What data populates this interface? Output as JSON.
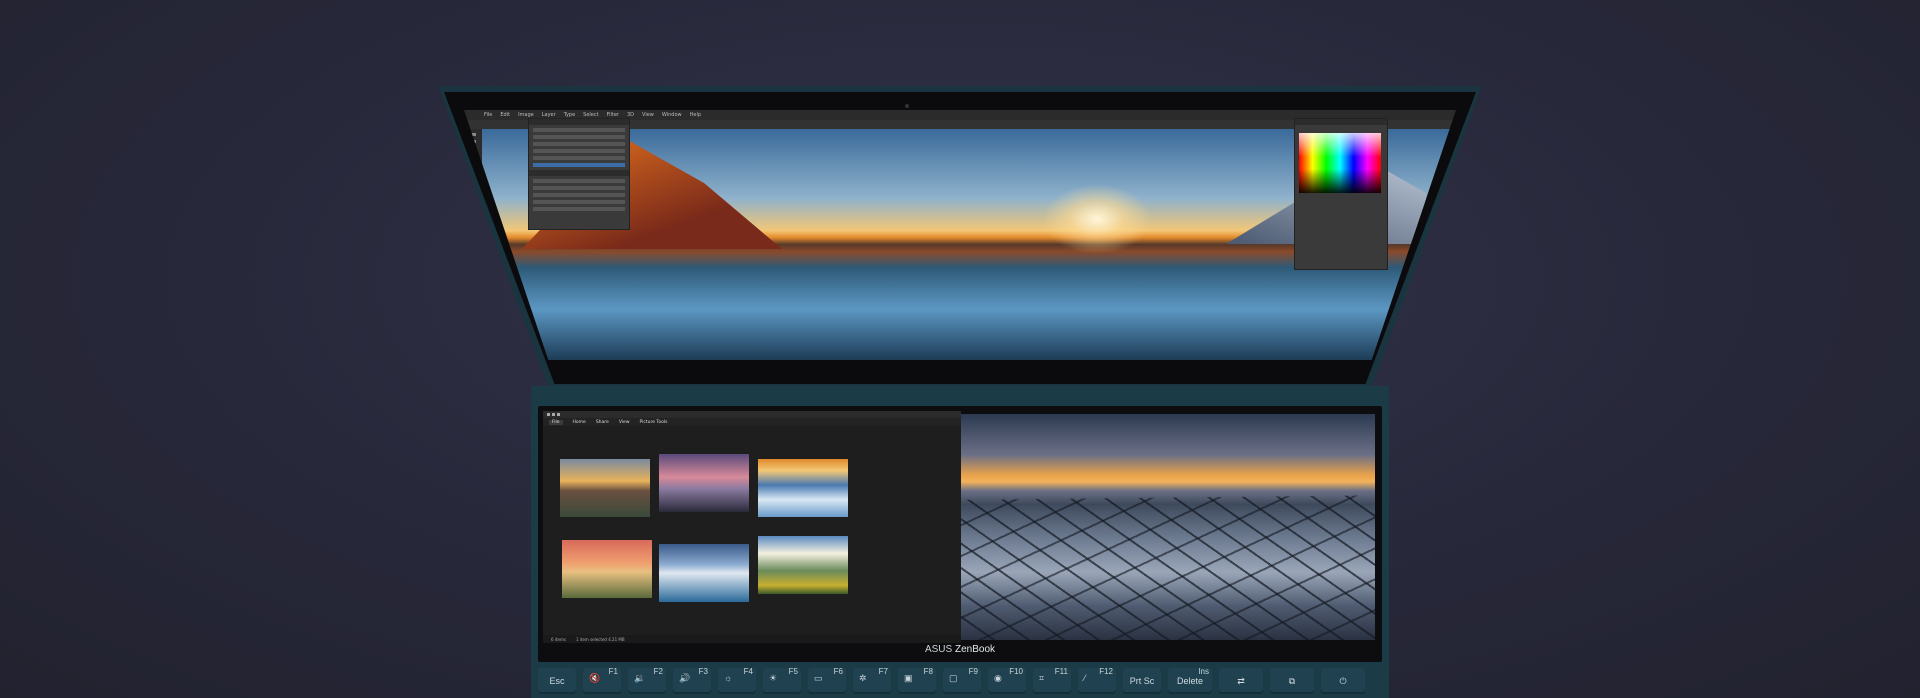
{
  "photoshop": {
    "menu": [
      "File",
      "Edit",
      "Image",
      "Layer",
      "Type",
      "Select",
      "Filter",
      "3D",
      "View",
      "Window",
      "Help"
    ]
  },
  "explorer": {
    "ribbon_tabs": [
      "File",
      "Home",
      "Share",
      "View",
      "Picture Tools"
    ],
    "status_items": [
      "6 items",
      "1 item selected 4.21 MB"
    ]
  },
  "brand": {
    "prefix": "ASUS",
    "name": "ZenBook"
  },
  "keyboard": {
    "keys": [
      {
        "label": "Esc",
        "fn": "",
        "icon": ""
      },
      {
        "label": "",
        "fn": "F1",
        "icon": "mute-icon"
      },
      {
        "label": "",
        "fn": "F2",
        "icon": "volume-down-icon"
      },
      {
        "label": "",
        "fn": "F3",
        "icon": "volume-up-icon"
      },
      {
        "label": "",
        "fn": "F4",
        "icon": "brightness-down-icon"
      },
      {
        "label": "",
        "fn": "F5",
        "icon": "brightness-up-icon"
      },
      {
        "label": "",
        "fn": "F6",
        "icon": "touchpad-icon"
      },
      {
        "label": "",
        "fn": "F7",
        "icon": "backlight-icon"
      },
      {
        "label": "",
        "fn": "F8",
        "icon": "display-icon"
      },
      {
        "label": "",
        "fn": "F9",
        "icon": "screen-lock-icon"
      },
      {
        "label": "",
        "fn": "F10",
        "icon": "camera-icon"
      },
      {
        "label": "",
        "fn": "F11",
        "icon": "screenshot-icon"
      },
      {
        "label": "",
        "fn": "F12",
        "icon": "myasus-icon"
      },
      {
        "label": "Prt Sc",
        "fn": "",
        "icon": ""
      },
      {
        "label": "Delete",
        "fn": "Ins",
        "icon": ""
      },
      {
        "label": "",
        "fn": "",
        "icon": "screenpad-toggle-icon"
      },
      {
        "label": "",
        "fn": "",
        "icon": "app-switch-icon"
      },
      {
        "label": "",
        "fn": "",
        "icon": "power-icon"
      }
    ]
  }
}
